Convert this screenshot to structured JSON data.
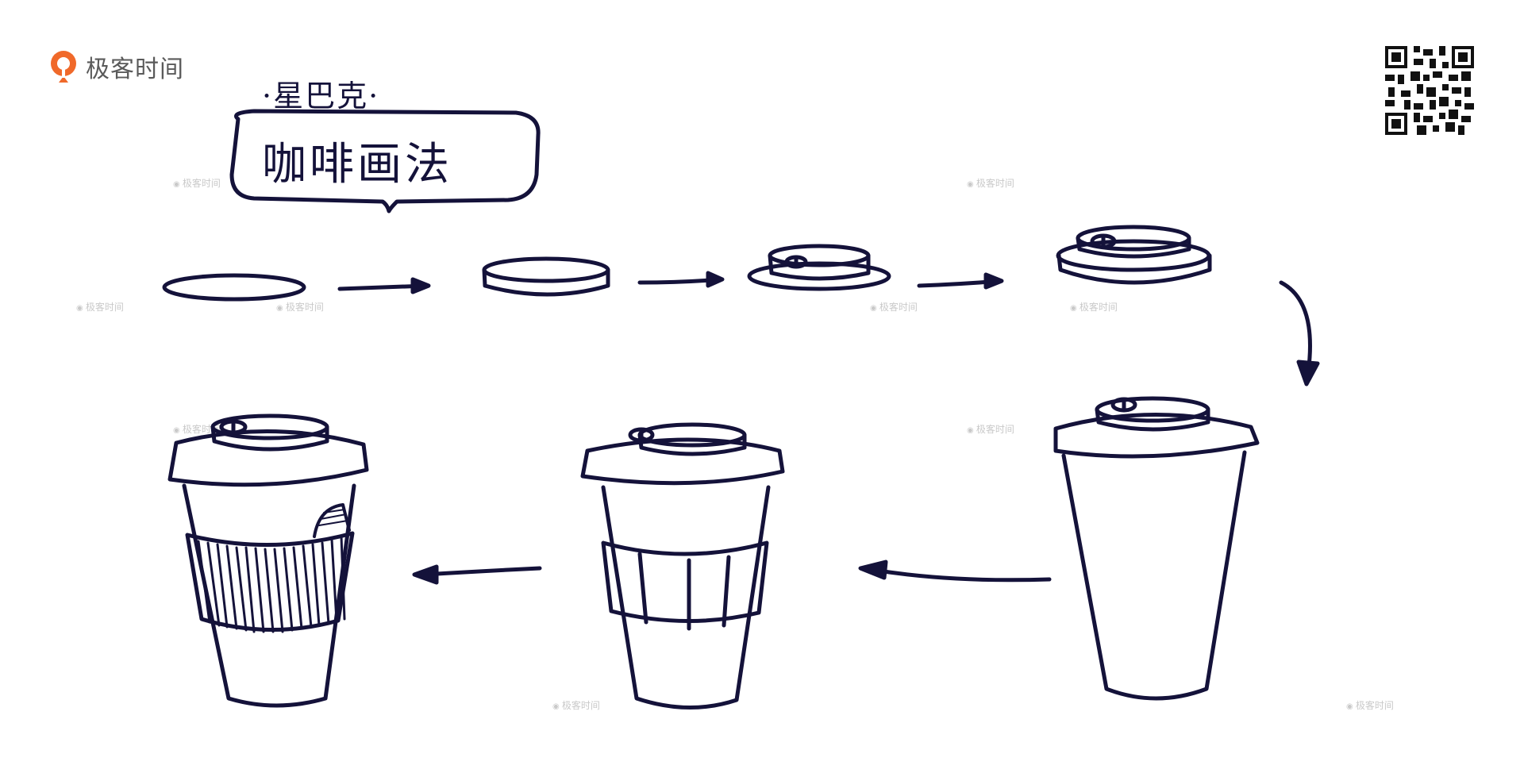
{
  "brand": {
    "name": "极客时间",
    "logo_icon": "geektime-logo-icon",
    "logo_color": "#f0692a"
  },
  "title": {
    "subtitle": "·星巴克·",
    "main": "咖啡画法"
  },
  "watermark": "极客时间",
  "ink_color": "#14123a",
  "steps": [
    {
      "id": 1,
      "shape": "ellipse"
    },
    {
      "id": 2,
      "shape": "disc"
    },
    {
      "id": 3,
      "shape": "lid-with-rim"
    },
    {
      "id": 4,
      "shape": "full-lid"
    },
    {
      "id": 5,
      "shape": "cup-with-lid"
    },
    {
      "id": 6,
      "shape": "cup-with-sleeve"
    },
    {
      "id": 7,
      "shape": "cup-with-ribbed-sleeve"
    }
  ],
  "qr_icon": "qr-code-icon"
}
